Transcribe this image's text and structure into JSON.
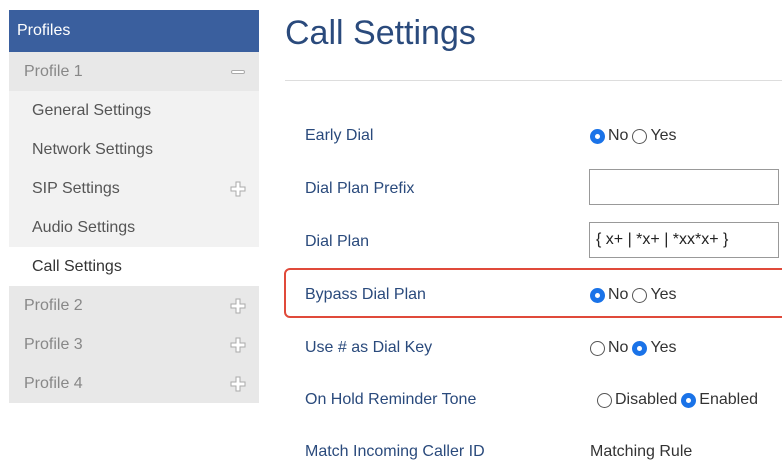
{
  "sidebar": {
    "header": "Profiles",
    "profile1": {
      "label": "Profile 1",
      "items": [
        {
          "label": "General Settings"
        },
        {
          "label": "Network Settings"
        },
        {
          "label": "SIP Settings"
        },
        {
          "label": "Audio Settings"
        },
        {
          "label": "Call Settings"
        }
      ]
    },
    "profiles": [
      {
        "label": "Profile 2"
      },
      {
        "label": "Profile 3"
      },
      {
        "label": "Profile 4"
      }
    ]
  },
  "main": {
    "title": "Call Settings",
    "fields": {
      "early_dial": {
        "label": "Early Dial",
        "options": [
          "No",
          "Yes"
        ],
        "selected": "No"
      },
      "dial_plan_prefix": {
        "label": "Dial Plan Prefix",
        "value": ""
      },
      "dial_plan": {
        "label": "Dial Plan",
        "value": "{ x+ | *x+ | *xx*x+ }"
      },
      "bypass_dial_plan": {
        "label": "Bypass Dial Plan",
        "options": [
          "No",
          "Yes"
        ],
        "selected": "No"
      },
      "use_hash_dial_key": {
        "label": "Use # as Dial Key",
        "options": [
          "No",
          "Yes"
        ],
        "selected": "Yes"
      },
      "on_hold_reminder_tone": {
        "label": "On Hold Reminder Tone",
        "options": [
          "Disabled",
          "Enabled"
        ],
        "selected": "Enabled"
      },
      "match_incoming_caller_id": {
        "label": "Match Incoming Caller ID",
        "value": "Matching Rule"
      }
    }
  },
  "colors": {
    "sidebar_header": "#3a5f9e",
    "title": "#2a4a7c",
    "label": "#2a4a7c",
    "highlight_border": "#e04a3a",
    "radio_checked": "#1a73e8"
  }
}
